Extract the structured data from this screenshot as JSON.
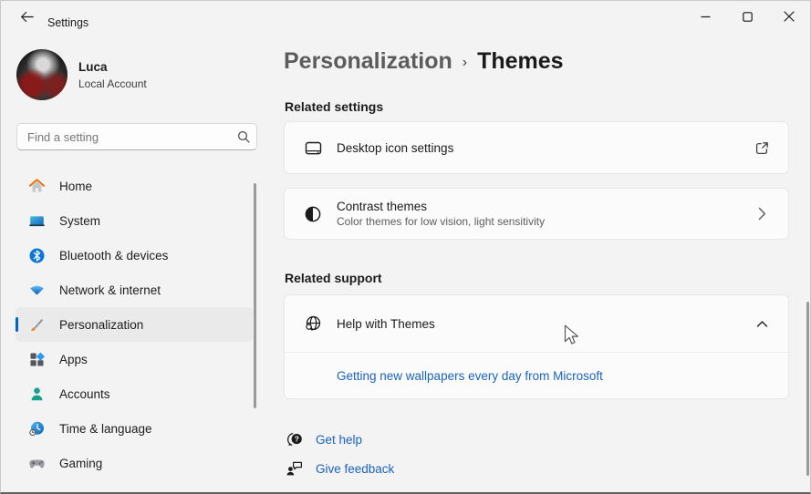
{
  "window": {
    "title": "Settings",
    "controls": [
      {
        "name": "minimize"
      },
      {
        "name": "maximize"
      },
      {
        "name": "close"
      }
    ]
  },
  "user": {
    "name": "Luca",
    "account_type": "Local Account"
  },
  "search": {
    "placeholder": "Find a setting",
    "icon": "magnifier-icon"
  },
  "sidebar": {
    "items": [
      {
        "label": "Home",
        "icon": "home-icon",
        "selected": false
      },
      {
        "label": "System",
        "icon": "system-icon",
        "selected": false
      },
      {
        "label": "Bluetooth & devices",
        "icon": "bluetooth-icon",
        "selected": false
      },
      {
        "label": "Network & internet",
        "icon": "network-icon",
        "selected": false
      },
      {
        "label": "Personalization",
        "icon": "personalization-icon",
        "selected": true
      },
      {
        "label": "Apps",
        "icon": "apps-icon",
        "selected": false
      },
      {
        "label": "Accounts",
        "icon": "accounts-icon",
        "selected": false
      },
      {
        "label": "Time & language",
        "icon": "time-language-icon",
        "selected": false
      },
      {
        "label": "Gaming",
        "icon": "gaming-icon",
        "selected": false
      }
    ]
  },
  "breadcrumb": {
    "parent": "Personalization",
    "separator": "›",
    "current": "Themes"
  },
  "related_settings": {
    "heading": "Related settings",
    "cards": [
      {
        "title": "Desktop icon settings",
        "icon": "desktop-monitor-icon",
        "trailing": "external-link-icon"
      },
      {
        "title": "Contrast themes",
        "subtitle": "Color themes for low vision, light sensitivity",
        "icon": "contrast-icon",
        "trailing": "chevron-right-icon"
      }
    ]
  },
  "related_support": {
    "heading": "Related support",
    "card": {
      "title": "Help with Themes",
      "icon": "globe-search-icon",
      "state": "expanded",
      "trailing": "chevron-up-icon",
      "links": [
        {
          "label": "Getting new wallpapers every day from Microsoft"
        }
      ]
    }
  },
  "footer": {
    "links": [
      {
        "label": "Get help",
        "icon": "get-help-icon"
      },
      {
        "label": "Give feedback",
        "icon": "feedback-icon"
      }
    ]
  },
  "colors": {
    "accent": "#0067c0",
    "link": "#1a63c0",
    "window_bg": "#f3f3f3",
    "card_bg": "#fbfbfb",
    "card_border": "#e7e7e7",
    "selected_nav_bg": "#eaeaea",
    "text_primary": "#1b1b1b",
    "text_secondary": "#5d5d5d"
  }
}
